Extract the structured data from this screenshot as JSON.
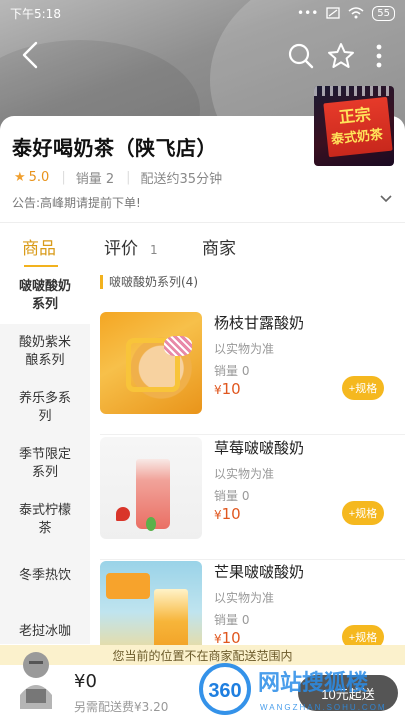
{
  "status": {
    "time": "下午5:18",
    "battery": "55"
  },
  "store": {
    "name": "泰好喝奶茶（陕飞店）",
    "rating": "5.0",
    "sales": "销量 2",
    "delivery": "配送约35分钟",
    "notice": "公告:高峰期请提前下单!"
  },
  "tabs": [
    {
      "label": "商品"
    },
    {
      "label": "评价",
      "count": "1"
    },
    {
      "label": "商家"
    }
  ],
  "categories": [
    "啵啵酸奶系列",
    "酸奶紫米酿系列",
    "养乐多系列",
    "季节限定系列",
    "泰式柠檬茶",
    "冬季热饮",
    "老挝冰咖"
  ],
  "section_title": "啵啵酸奶系列(4)",
  "products": [
    {
      "name": "杨枝甘露酸奶",
      "desc": "以实物为准",
      "sales": "销量 0",
      "price": "10",
      "currency": "¥",
      "button": "+规格"
    },
    {
      "name": "草莓啵啵酸奶",
      "desc": "以实物为准",
      "sales": "销量 0",
      "price": "10",
      "currency": "¥",
      "button": "+规格"
    },
    {
      "name": "芒果啵啵酸奶",
      "desc": "以实物为准",
      "sales": "销量 0",
      "price": "10",
      "currency": "¥",
      "button": "+规格"
    }
  ],
  "range_notice": "您当前的位置不在商家配送范围内",
  "cart": {
    "total": "¥0",
    "delivery_fee": "另需配送费¥3.20",
    "checkout": "10元起送"
  },
  "colors": {
    "accent": "#f2b21e",
    "price": "#e0571f",
    "notice_bg": "#fbf1cc"
  },
  "watermark": {
    "brand": "360",
    "text": "网站搜狐楼",
    "sub": "WANGZHAN.SOHU.COM"
  }
}
